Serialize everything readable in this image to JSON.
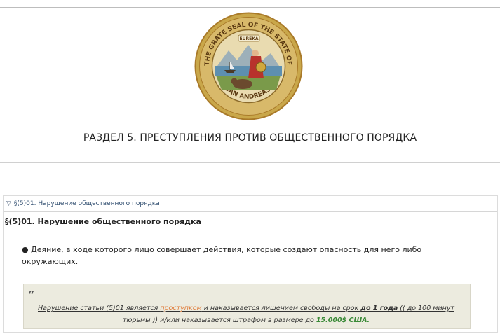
{
  "seal": {
    "ring_text_top": "THE GRATE SEAL OF THE STATE OF",
    "ring_text_bottom": "SAN ANDREAS",
    "banner_text": "EUREKA",
    "colors": {
      "gold": "#c9a74a",
      "ring": "#b07a2d",
      "center": "#e9dbb0"
    }
  },
  "page": {
    "heading": "РАЗДЕЛ 5. ПРЕСТУПЛЕНИЯ ПРОТИВ ОБЩЕСТВЕННОГО ПОРЯДКА"
  },
  "article": {
    "summary_icon": "triangle-down-icon",
    "summary": "§(5)01. Нарушение общественного порядка",
    "title": "§(5)01. Нарушение общественного порядка",
    "bullet": "● Деяние, в ходе которого лицо совершает действия, которые создают опасность для него либо окружающих.",
    "quote": {
      "mark": "“",
      "part1": "Нарушение статьи (5)01 является ",
      "term": "проступком",
      "part2": " и наказывается лишением свободы на срок ",
      "term_duration": "до 1 года",
      "part3": " (( до 100 минут тюрьмы )) и/или наказывается штрафом в размере до ",
      "fine": "15.000$ США."
    }
  }
}
